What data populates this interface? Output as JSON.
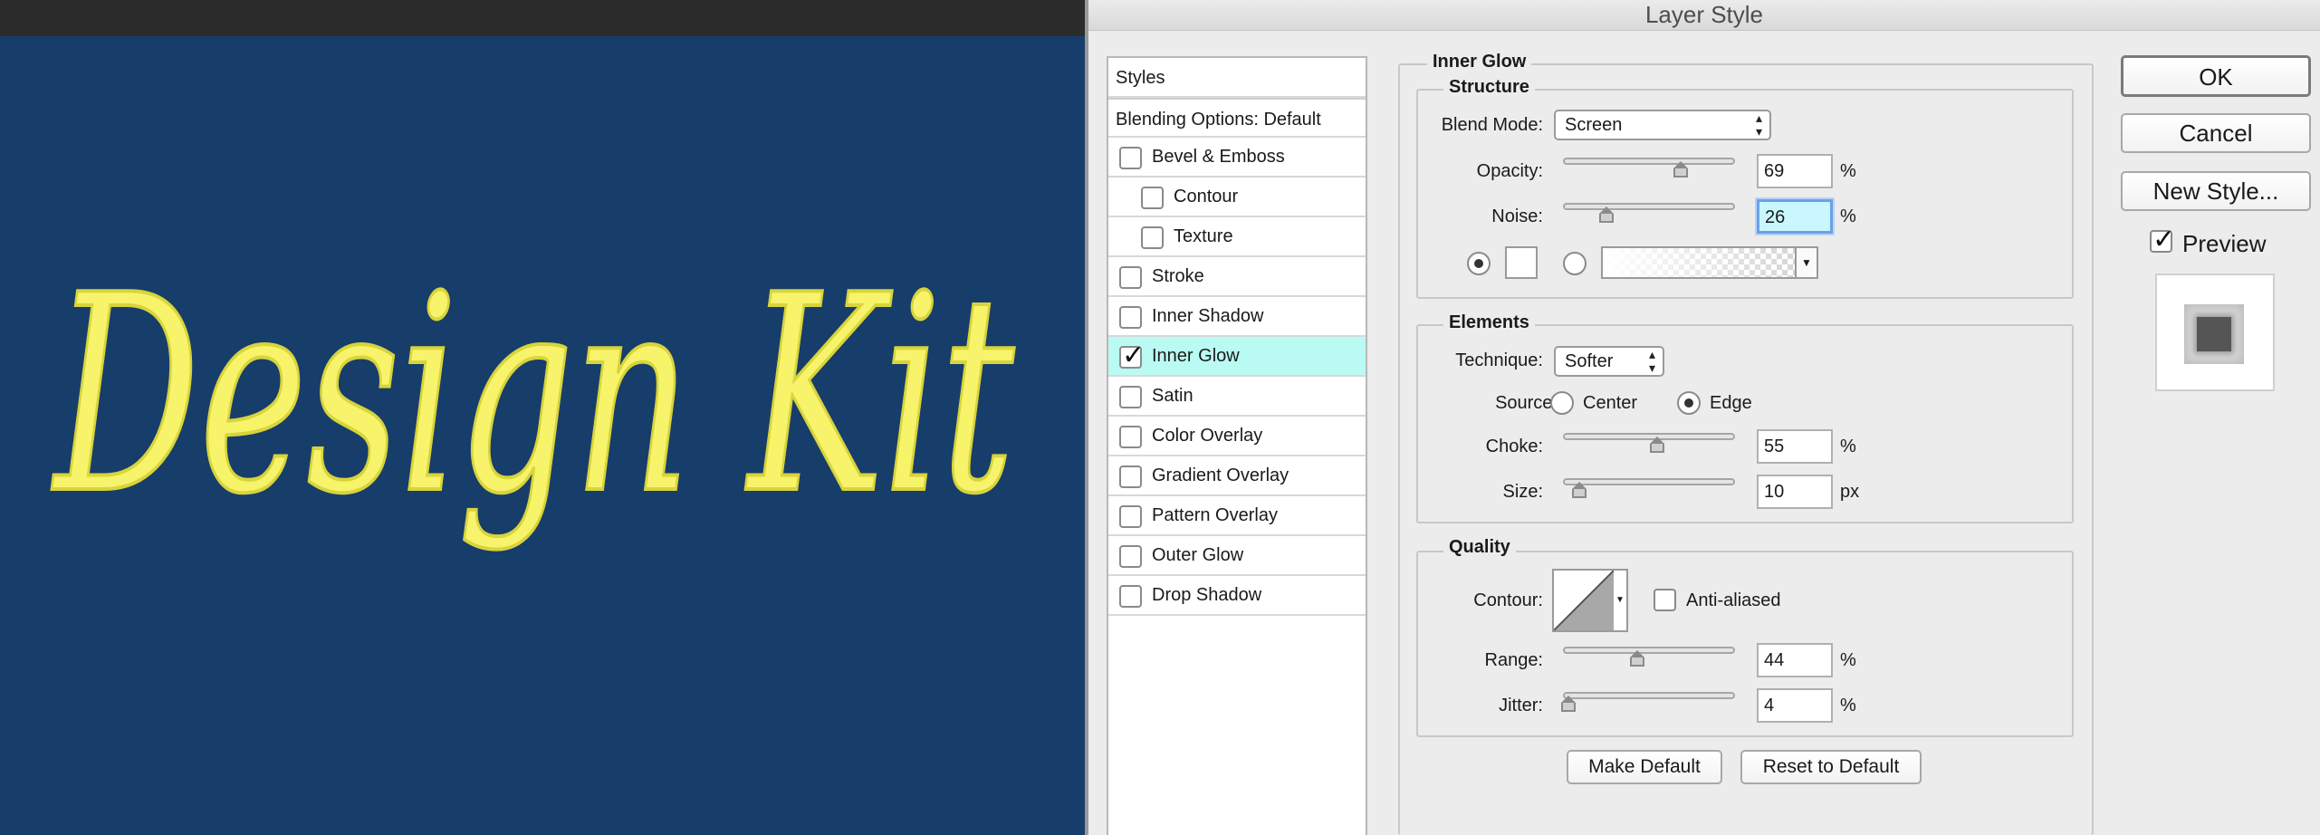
{
  "canvas": {
    "text": "Design Kit",
    "background_color": "#173d6b",
    "text_color": "#f7f36b"
  },
  "dialog": {
    "title": "Layer Style"
  },
  "styles_panel": {
    "header": "Styles",
    "blending_options": "Blending Options: Default",
    "items": [
      {
        "label": "Bevel & Emboss",
        "checked": false
      },
      {
        "label": "Contour",
        "checked": false
      },
      {
        "label": "Texture",
        "checked": false
      },
      {
        "label": "Stroke",
        "checked": false
      },
      {
        "label": "Inner Shadow",
        "checked": false
      },
      {
        "label": "Inner Glow",
        "checked": true,
        "selected": true
      },
      {
        "label": "Satin",
        "checked": false
      },
      {
        "label": "Color Overlay",
        "checked": false
      },
      {
        "label": "Gradient Overlay",
        "checked": false
      },
      {
        "label": "Pattern Overlay",
        "checked": false
      },
      {
        "label": "Outer Glow",
        "checked": false
      },
      {
        "label": "Drop Shadow",
        "checked": false
      }
    ]
  },
  "inner_glow": {
    "title": "Inner Glow",
    "structure": {
      "title": "Structure",
      "blend_mode_label": "Blend Mode:",
      "blend_mode_value": "Screen",
      "opacity_label": "Opacity:",
      "opacity_value": "69",
      "noise_label": "Noise:",
      "noise_value": "26",
      "percent": "%"
    },
    "elements": {
      "title": "Elements",
      "technique_label": "Technique:",
      "technique_value": "Softer",
      "source_label": "Source:",
      "source_center": "Center",
      "source_edge": "Edge",
      "choke_label": "Choke:",
      "choke_value": "55",
      "size_label": "Size:",
      "size_value": "10",
      "px": "px"
    },
    "quality": {
      "title": "Quality",
      "contour_label": "Contour:",
      "anti_aliased_label": "Anti-aliased",
      "range_label": "Range:",
      "range_value": "44",
      "jitter_label": "Jitter:",
      "jitter_value": "4"
    },
    "make_default": "Make Default",
    "reset_to_default": "Reset to Default"
  },
  "actions": {
    "ok": "OK",
    "cancel": "Cancel",
    "new_style": "New Style...",
    "preview_label": "Preview",
    "preview_checked": true
  },
  "icons": {
    "checkbox_checked": "checkmark-icon",
    "select_arrows": "updown-chevron-icon",
    "dropdown": "caret-down-icon"
  }
}
